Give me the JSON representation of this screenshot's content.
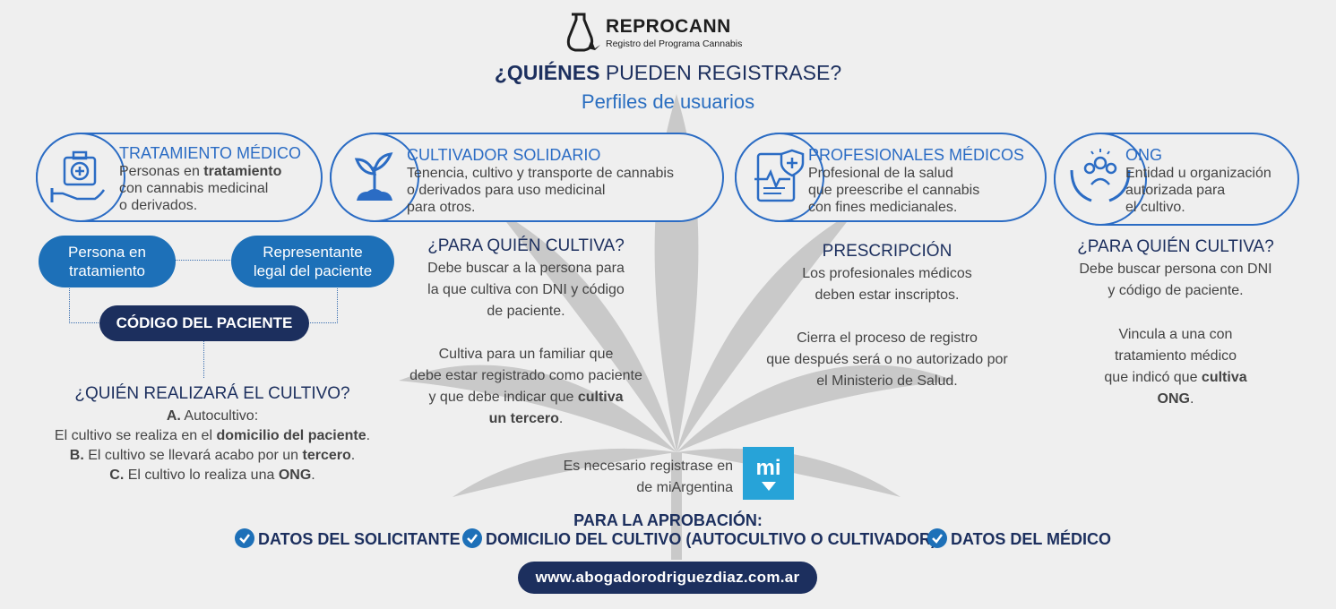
{
  "brand": {
    "name": "REPROCANN",
    "subtitle": "Registro del Programa Cannabis"
  },
  "heading": {
    "bold": "¿QUIÉNES",
    "rest": " PUEDEN REGISTRASE?",
    "subtitle": "Perfiles de usuarios"
  },
  "cards": [
    {
      "title": "TRATAMIENTO MÉDICO",
      "lines": [
        [
          "Personas en ",
          "tratamiento",
          ""
        ],
        [
          "con cannabis medicinal",
          "",
          ""
        ],
        [
          "o derivados.",
          "",
          ""
        ]
      ]
    },
    {
      "title": "CULTIVADOR SOLIDARIO",
      "lines": [
        "Tenencia, cultivo y transporte de cannabis",
        "o derivados para uso medicinal",
        "para otros."
      ]
    },
    {
      "title": "PROFESIONALES MÉDICOS",
      "lines": [
        "Profesional de la salud",
        "que preescribe el cannabis",
        "con fines medicianales."
      ]
    },
    {
      "title": "ONG",
      "lines": [
        "Entidad u organización",
        "autorizada para",
        "el cultivo."
      ]
    }
  ],
  "patient": {
    "pill_left_1": "Persona en",
    "pill_left_2": "tratamiento",
    "pill_right_1": "Representante",
    "pill_right_2": "legal del paciente",
    "code": "CÓDIGO DEL PACIENTE",
    "question": "¿QUIÉN REALIZARÁ EL CULTIVO?",
    "a_label": "A.",
    "a_text": " Autocultivo:",
    "a2_pre": "El cultivo se realiza en el ",
    "a2_bold": "domicilio del paciente",
    "a2_post": ".",
    "b_label": "B.",
    "b_pre": " El cultivo se llevará acabo por un ",
    "b_bold": "tercero",
    "b_post": ".",
    "c_label": "C.",
    "c_pre": " El cultivo lo realiza una ",
    "c_bold": "ONG",
    "c_post": "."
  },
  "cultivator": {
    "question": "¿PARA QUIÉN CULTIVA?",
    "p1": [
      "Debe buscar a la persona para",
      "la que cultiva con DNI y código",
      "de paciente."
    ],
    "p2_l1": "Cultiva para un familiar que",
    "p2_l2": "debe estar registrado como paciente",
    "p2_l3_pre": "y que debe indicar  que ",
    "p2_l3_bold": "cultiva",
    "p2_l4_bold": "un tercero",
    "p2_l4_post": "."
  },
  "prescription": {
    "title": "PRESCRIPCIÓN",
    "p1": [
      "Los profesionales médicos",
      "deben estar inscriptos."
    ],
    "p2": [
      "Cierra el proceso de registro",
      "que después será o no autorizado por",
      "el Ministerio de Salud."
    ]
  },
  "ong": {
    "question": "¿PARA QUIÉN CULTIVA?",
    "p1": [
      "Debe buscar persona con DNI",
      "y código de paciente."
    ],
    "p2_l1": "Vincula a una con",
    "p2_l2": "tratamiento médico",
    "p2_l3_pre": "que indicó que ",
    "p2_l3_bold": "cultiva",
    "p2_l4_bold": "ONG",
    "p2_l4_post": "."
  },
  "miargentina": {
    "line1": "Es necesario registrase en",
    "line2": "de miArgentina",
    "logo": "mi"
  },
  "approval": {
    "title": "PARA LA APROBACIÓN:",
    "items": [
      "DATOS DEL SOLICITANTE",
      "DOMICILIO DEL CULTIVO (AUTOCULTIVO O CULTIVADOR)",
      "DATOS DEL MÉDICO"
    ]
  },
  "url": "www.abogadorodriguezdiaz.com.ar",
  "colors": {
    "navy": "#1c2f5e",
    "blue": "#2b6cc4",
    "pill": "#1d70b8",
    "mi": "#27a3d8",
    "background": "#efefef"
  }
}
